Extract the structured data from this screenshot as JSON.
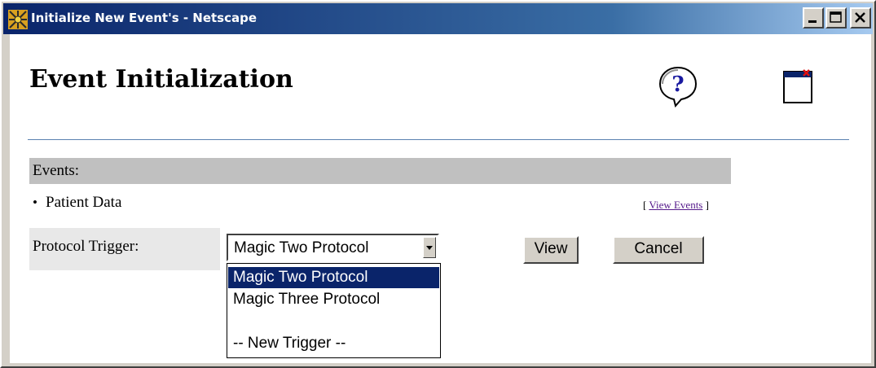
{
  "window": {
    "title": "Initialize New Event's - Netscape",
    "app_icon": "netscape-icon",
    "controls": [
      "minimize-icon",
      "maximize-icon",
      "close-icon"
    ]
  },
  "page": {
    "title": "Event Initialization",
    "help_icon": "help-question-icon",
    "close_window_icon": "close-window-icon"
  },
  "events_section": {
    "header": "Events:",
    "bullet": "•",
    "item": "Patient Data",
    "link_open": "[",
    "link_text": "View Events",
    "link_close": "]"
  },
  "trigger": {
    "label": "Protocol Trigger:",
    "selected": "Magic Two Protocol",
    "options": [
      "Magic Two Protocol",
      "Magic Three Protocol",
      "",
      "-- New Trigger --"
    ],
    "highlighted_index": 0
  },
  "buttons": {
    "view": "View",
    "cancel": "Cancel"
  },
  "colors": {
    "titlebar_start": "#0a246a",
    "titlebar_end": "#a6caf0",
    "events_bar": "#c0c0c0",
    "highlight": "#0a246a",
    "link": "#551a8b"
  }
}
